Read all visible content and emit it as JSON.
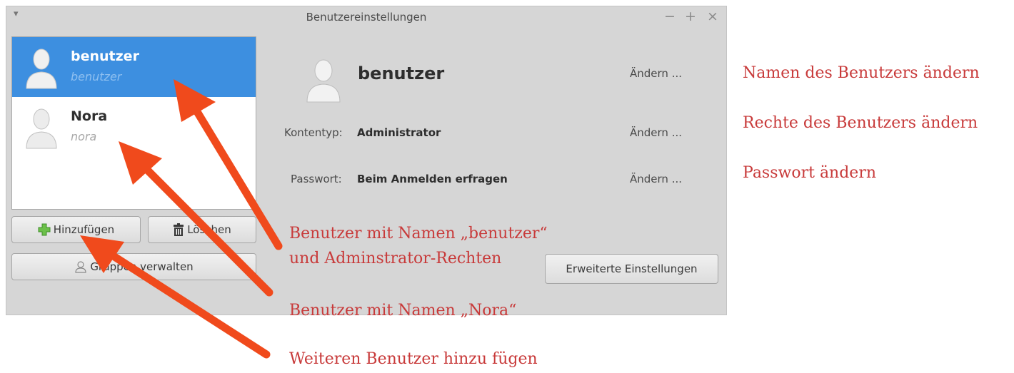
{
  "window": {
    "title": "Benutzereinstellungen",
    "menu_glyph": "▾",
    "minimize_glyph": "−",
    "maximize_glyph": "+",
    "close_glyph": "×"
  },
  "users": [
    {
      "name": "benutzer",
      "login": "benutzer",
      "selected": true
    },
    {
      "name": "Nora",
      "login": "nora",
      "selected": false
    }
  ],
  "buttons": {
    "add": "Hinzufügen",
    "delete": "Löschen",
    "groups": "Gruppen verwalten",
    "advanced": "Erweiterte Einstellungen"
  },
  "details": {
    "name": "benutzer",
    "change_link": "Ändern ...",
    "account_type_label": "Kontentyp:",
    "account_type_value": "Administrator",
    "password_label": "Passwort:",
    "password_value": "Beim Anmelden erfragen"
  },
  "annotations": {
    "change_name": "Namen des Benutzers ändern",
    "change_rights": "Rechte des Benutzers ändern",
    "change_password": "Passwort ändern",
    "user_benutzer_line1": "Benutzer mit Namen „benutzer“",
    "user_benutzer_line2": "und Adminstrator-Rechten",
    "user_nora": "Benutzer mit Namen „Nora“",
    "add_user": "Weiteren Benutzer hinzu fügen"
  },
  "colors": {
    "selection": "#3d8fe0",
    "annotation_text": "#c83a3a",
    "arrow": "#f04a1c"
  },
  "icons": {
    "avatar": "user-avatar-icon",
    "add": "green-plus-icon",
    "delete": "trash-icon",
    "groups": "user-outline-icon"
  }
}
